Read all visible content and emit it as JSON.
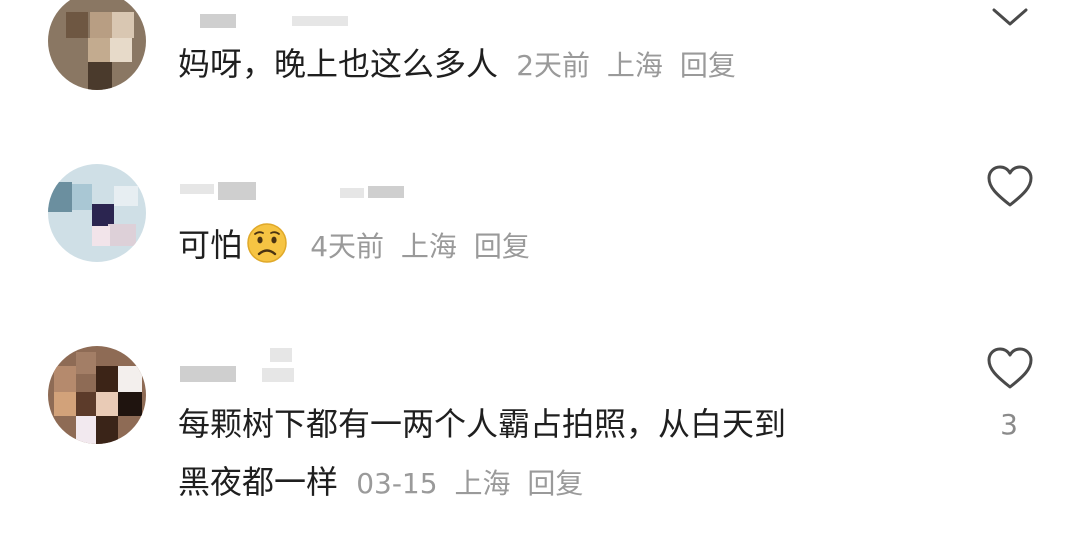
{
  "comments": [
    {
      "text": "妈呀，晚上也这么多人",
      "time": "2天前",
      "location": "上海",
      "reply_label": "回复"
    },
    {
      "text": "可怕",
      "emoji": "worried-face",
      "time": "4天前",
      "location": "上海",
      "reply_label": "回复"
    },
    {
      "text_line1": "每颗树下都有一两个人霸占拍照，从白天到",
      "text_line2": "黑夜都一样",
      "time": "03-15",
      "location": "上海",
      "reply_label": "回复",
      "like_count": "3"
    }
  ],
  "icons": {
    "like": "heart-outline-icon",
    "collapse": "chevron-down-icon"
  },
  "colors": {
    "text": "#1f1f1f",
    "meta": "#9a9a9a",
    "icon": "#4a4a4a",
    "emoji": "#f6c443"
  }
}
